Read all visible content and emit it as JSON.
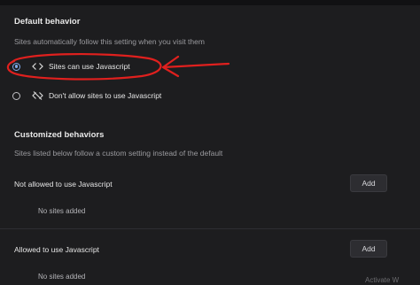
{
  "default_behavior": {
    "title": "Default behavior",
    "description": "Sites automatically follow this setting when you visit them",
    "options": [
      {
        "label": "Sites can use Javascript",
        "selected": true,
        "icon": "code-brackets-icon"
      },
      {
        "label": "Don't allow sites to use Javascript",
        "selected": false,
        "icon": "code-off-icon"
      }
    ]
  },
  "customized_behaviors": {
    "title": "Customized behaviors",
    "description": "Sites listed below follow a custom setting instead of the default",
    "not_allowed": {
      "label": "Not allowed to use Javascript",
      "add_label": "Add",
      "empty_text": "No sites added"
    },
    "allowed": {
      "label": "Allowed to use Javascript",
      "add_label": "Add",
      "empty_text": "No sites added"
    }
  },
  "annotation": {
    "color": "#e0201e"
  },
  "watermark": "Activate W"
}
